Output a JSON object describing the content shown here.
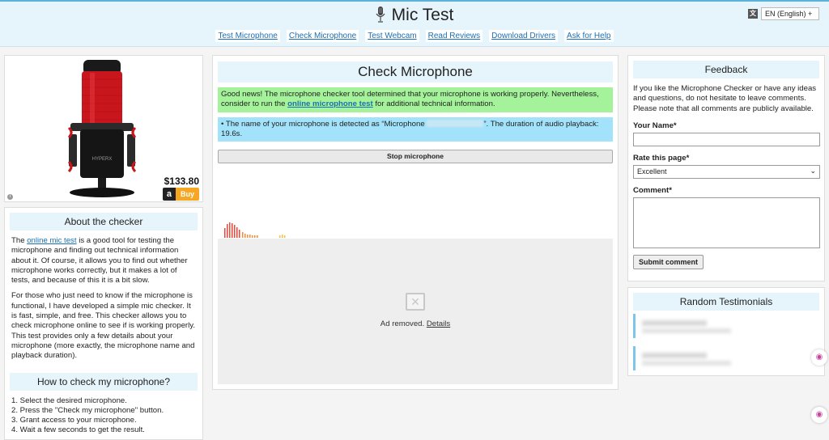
{
  "header": {
    "title": "Mic Test",
    "nav": [
      "Test Microphone",
      "Check Microphone",
      "Test Webcam",
      "Read Reviews",
      "Download Drivers",
      "Ask for Help"
    ],
    "language": "EN (English) +",
    "language_icon": "translate-icon"
  },
  "product": {
    "price": "$133.80",
    "buy_label": "Buy",
    "badge": "a",
    "info": "i"
  },
  "about": {
    "title": "About the checker",
    "p1_link": "online mic test",
    "p1_rest": " is a good tool for testing the microphone and finding out technical information about it. Of course, it allows you to find out whether microphone works correctly, but it makes a lot of tests, and because of this it is a bit slow.",
    "p1_prefix": "The ",
    "p2": "For those who just need to know if the microphone is functional, I have developed a simple mic checker. It is fast, simple, and free. This checker allows you to check microphone online to see if is working properly. This test provides only a few details about your microphone (more exactly, the microphone name and playback duration).",
    "howto_title": "How to check my microphone?",
    "steps": [
      "1. Select the desired microphone.",
      "2. Press the \"Check my microphone\" button.",
      "3. Grant access to your microphone.",
      "4. Wait a few seconds to get the result."
    ]
  },
  "main": {
    "title": "Check Microphone",
    "green_text_1": "Good news! The microphone checker tool determined that your microphone is working properly. Nevertheless, consider to run the ",
    "green_link": "online microphone test",
    "green_text_2": " for additional technical information.",
    "blue_text_1": "• The name of your microphone is detected as “Microphone ",
    "blue_text_2": "”. The duration of audio playback: 19.6s.",
    "stop_button": "Stop microphone",
    "ad_text": "Ad removed.",
    "ad_link": "Details",
    "ad_icon": "broken-image-icon"
  },
  "feedback": {
    "title": "Feedback",
    "intro": "If you like the Microphone Checker or have any ideas and questions, do not hesitate to leave comments. Please note that all comments are publicly available.",
    "name_label": "Your Name*",
    "rate_label": "Rate this page*",
    "rate_value": "Excellent",
    "comment_label": "Comment*",
    "submit": "Submit comment"
  },
  "testimonials": {
    "title": "Random Testimonials"
  },
  "colors": {
    "header_bg": "#e6f4fb",
    "success_bg": "#a4f39a",
    "info_bg": "#a2e3fb",
    "buy_orange": "#f5a623",
    "link": "#1a6fb5"
  }
}
